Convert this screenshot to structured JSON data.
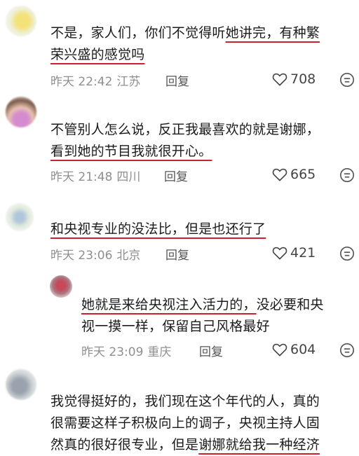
{
  "comments": [
    {
      "lines": [
        [
          {
            "t": "不是，家人们，你们不觉得听",
            "u": false
          },
          {
            "t": "她讲完，有种繁",
            "u": true
          }
        ],
        [
          {
            "t": "荣兴盛的感觉吗",
            "u": true
          }
        ]
      ],
      "time": "昨天 22:42",
      "location": "江苏",
      "reply_label": "回复",
      "likes": "708"
    },
    {
      "lines": [
        [
          {
            "t": "不管别人怎么说，反正我最喜欢的就是谢娜，",
            "u": false
          }
        ],
        [
          {
            "t": "看到她的节目我就很开心。",
            "u": true
          }
        ]
      ],
      "time": "昨天 21:48",
      "location": "四川",
      "reply_label": "回复",
      "likes": "665"
    },
    {
      "lines": [
        [
          {
            "t": "和央视专业的没法比，但是也还行了",
            "u": true
          }
        ]
      ],
      "time": "昨天 23:06",
      "location": "北京",
      "reply_label": "回复",
      "likes": "421"
    },
    {
      "lines": [
        [
          {
            "t": "她就是来给央视注入活力的，",
            "u": true
          },
          {
            "t": "没必要和央",
            "u": false
          }
        ],
        [
          {
            "t": "视一摸一样，保留自己风格最好",
            "u": false
          }
        ]
      ],
      "time": "昨天 23:09",
      "location": "重庆",
      "reply_label": "回复",
      "likes": "604"
    },
    {
      "lines": [
        [
          {
            "t": "我觉得挺好的，我们现在这个年代的人，真的",
            "u": false
          }
        ],
        [
          {
            "t": "很需要这样子积极向上的调子，央视主持人固",
            "u": false
          }
        ],
        [
          {
            "t": "然真的很好很专业，但是",
            "u": false
          },
          {
            "t": "谢娜就给我一种经济",
            "u": true
          }
        ]
      ]
    }
  ],
  "colors": {
    "underline": "#c8232c",
    "meta": "#8f8f8f"
  },
  "icons": {
    "like": "heart-outline-icon",
    "more": "smile-face-icon"
  }
}
